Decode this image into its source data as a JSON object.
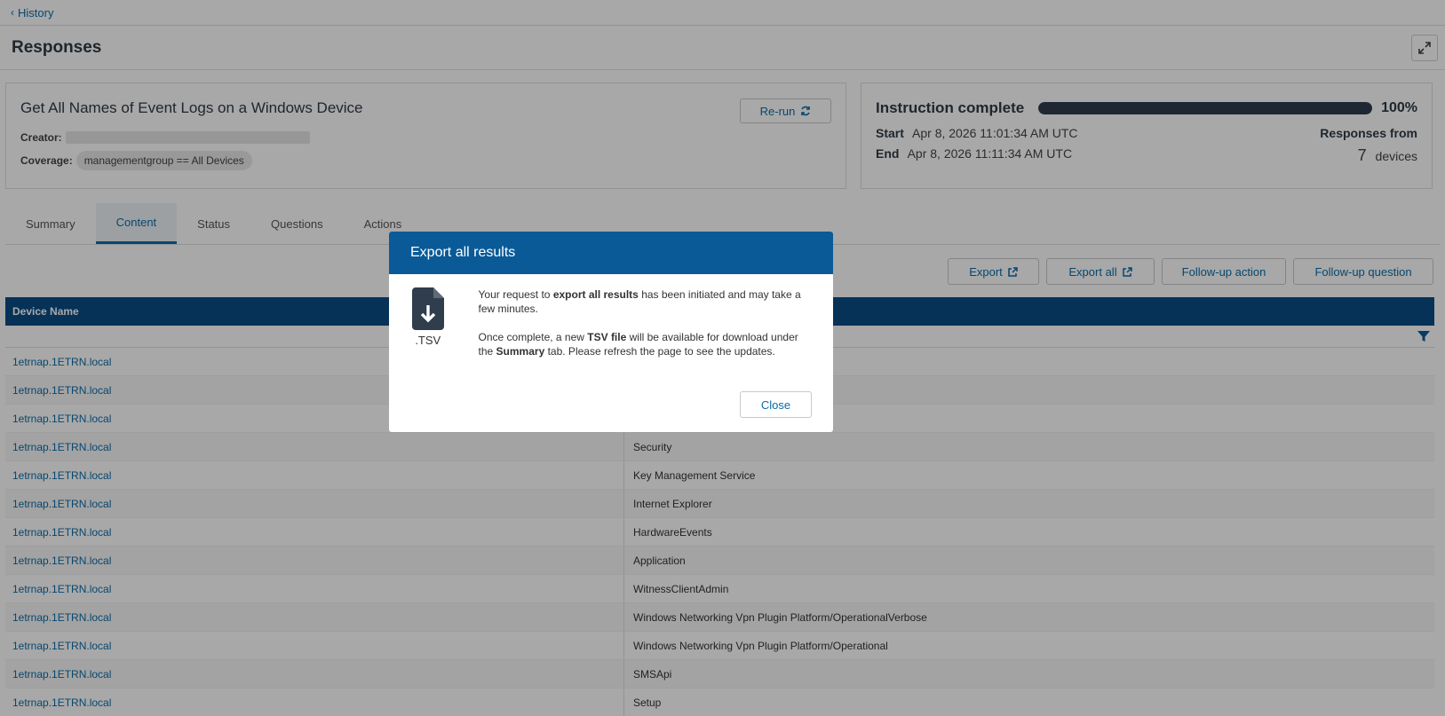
{
  "nav": {
    "back_label": "History"
  },
  "page": {
    "title": "Responses"
  },
  "question_card": {
    "title": "Get All Names of Event Logs on a Windows Device",
    "creator_label": "Creator:",
    "coverage_label": "Coverage:",
    "coverage_value": "managementgroup == All Devices",
    "rerun_label": "Re-run"
  },
  "status_card": {
    "title": "Instruction complete",
    "progress_percent": 100,
    "progress_label": "100%",
    "start_label": "Start",
    "start_value": "Apr 8, 2026 11:01:34 AM UTC",
    "end_label": "End",
    "end_value": "Apr 8, 2026 11:11:34 AM UTC",
    "responses_from_label": "Responses from",
    "device_count": "7",
    "devices_label": "devices"
  },
  "tabs": [
    {
      "label": "Summary"
    },
    {
      "label": "Content"
    },
    {
      "label": "Status"
    },
    {
      "label": "Questions"
    },
    {
      "label": "Actions"
    }
  ],
  "toolbar": {
    "export_label": "Export",
    "export_all_label": "Export all",
    "followup_action_label": "Follow-up action",
    "followup_question_label": "Follow-up question"
  },
  "table": {
    "col1_header": "Device Name",
    "rows": [
      {
        "device": "1etrnap.1ETRN.local",
        "value": ""
      },
      {
        "device": "1etrnap.1ETRN.local",
        "value": ""
      },
      {
        "device": "1etrnap.1ETRN.local",
        "value": ""
      },
      {
        "device": "1etrnap.1ETRN.local",
        "value": "Security"
      },
      {
        "device": "1etrnap.1ETRN.local",
        "value": "Key Management Service"
      },
      {
        "device": "1etrnap.1ETRN.local",
        "value": "Internet Explorer"
      },
      {
        "device": "1etrnap.1ETRN.local",
        "value": "HardwareEvents"
      },
      {
        "device": "1etrnap.1ETRN.local",
        "value": "Application"
      },
      {
        "device": "1etrnap.1ETRN.local",
        "value": "WitnessClientAdmin"
      },
      {
        "device": "1etrnap.1ETRN.local",
        "value": "Windows Networking Vpn Plugin Platform/OperationalVerbose"
      },
      {
        "device": "1etrnap.1ETRN.local",
        "value": "Windows Networking Vpn Plugin Platform/Operational"
      },
      {
        "device": "1etrnap.1ETRN.local",
        "value": "SMSApi"
      },
      {
        "device": "1etrnap.1ETRN.local",
        "value": "Setup"
      }
    ]
  },
  "modal": {
    "title": "Export all results",
    "file_ext": ".TSV",
    "p1_a": "Your request to ",
    "p1_b": "export all results",
    "p1_c": " has been initiated and may take a few minutes.",
    "p2_a": "Once complete, a new ",
    "p2_b": "TSV file",
    "p2_c": " will be available for download under the ",
    "p2_d": "Summary",
    "p2_e": " tab. Please refresh the page to see the updates.",
    "close_label": "Close"
  },
  "colors": {
    "accent": "#0b6ca8",
    "header_blue": "#0a5a98",
    "table_header": "#0a4d86"
  }
}
